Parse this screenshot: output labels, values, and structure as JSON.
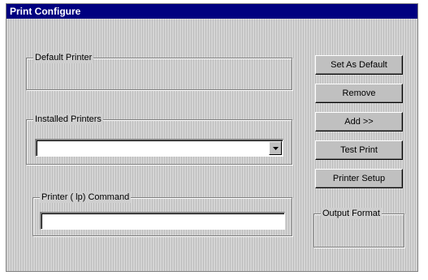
{
  "window": {
    "title": "Print Configure"
  },
  "groups": {
    "default_printer": {
      "label": "Default Printer"
    },
    "installed_printers": {
      "label": "Installed Printers",
      "selected_value": ""
    },
    "printer_command": {
      "label": "Printer ( lp) Command",
      "value": ""
    },
    "output_format": {
      "label": "Output Format"
    }
  },
  "buttons": {
    "set_as_default": "Set As Default",
    "remove": "Remove",
    "add": "Add >>",
    "test_print": "Test Print",
    "printer_setup": "Printer Setup"
  },
  "icons": {
    "dropdown": "chevron-down-icon"
  },
  "colors": {
    "titlebar": "#000080",
    "title_text": "#ffffff",
    "face": "#c0c0c0"
  }
}
